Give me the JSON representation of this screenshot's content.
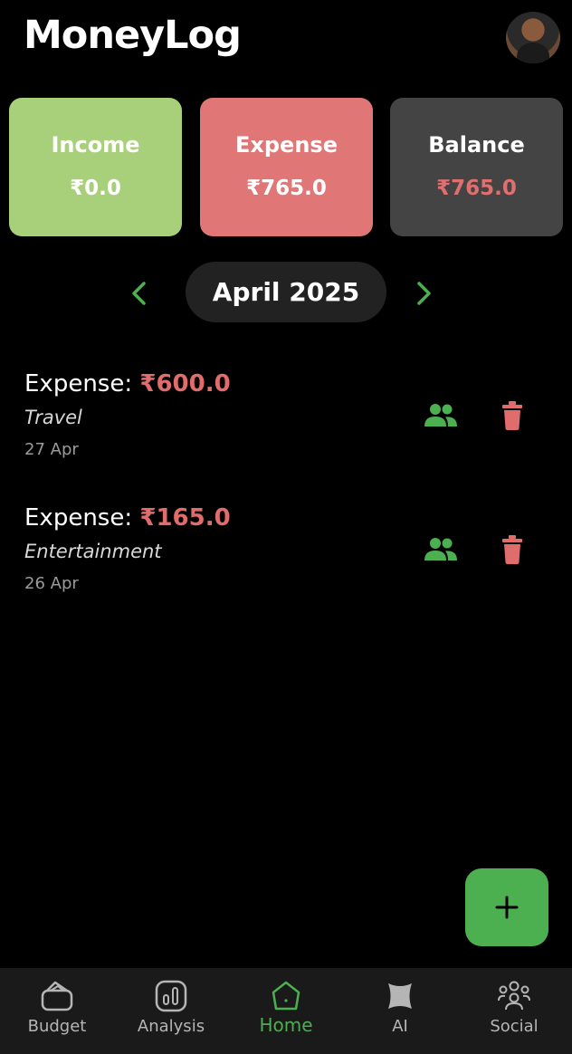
{
  "header": {
    "title": "MoneyLog",
    "avatar_icon": "user-avatar"
  },
  "summary": {
    "income": {
      "label": "Income",
      "value": "₹0.0"
    },
    "expense": {
      "label": "Expense",
      "value": "₹765.0"
    },
    "balance": {
      "label": "Balance",
      "value": "₹765.0"
    }
  },
  "month_nav": {
    "month": "April 2025",
    "prev_icon": "chevron-left",
    "next_icon": "chevron-right"
  },
  "transactions": [
    {
      "prefix": "Expense: ",
      "amount": "₹600.0",
      "category": "Travel",
      "date": "27 Apr"
    },
    {
      "prefix": "Expense: ",
      "amount": "₹165.0",
      "category": "Entertainment",
      "date": "26 Apr"
    }
  ],
  "fab": {
    "icon": "plus"
  },
  "bottom_nav": {
    "items": [
      {
        "label": "Budget",
        "icon": "wallet"
      },
      {
        "label": "Analysis",
        "icon": "bar-chart"
      },
      {
        "label": "Home",
        "icon": "home"
      },
      {
        "label": "AI",
        "icon": "ai"
      },
      {
        "label": "Social",
        "icon": "group"
      }
    ],
    "active": "Home"
  },
  "colors": {
    "income_card": "#a8d07a",
    "expense_card": "#e07676",
    "balance_card": "#444444",
    "expense_text": "#e06c6c",
    "accent_green": "#4caf50"
  }
}
